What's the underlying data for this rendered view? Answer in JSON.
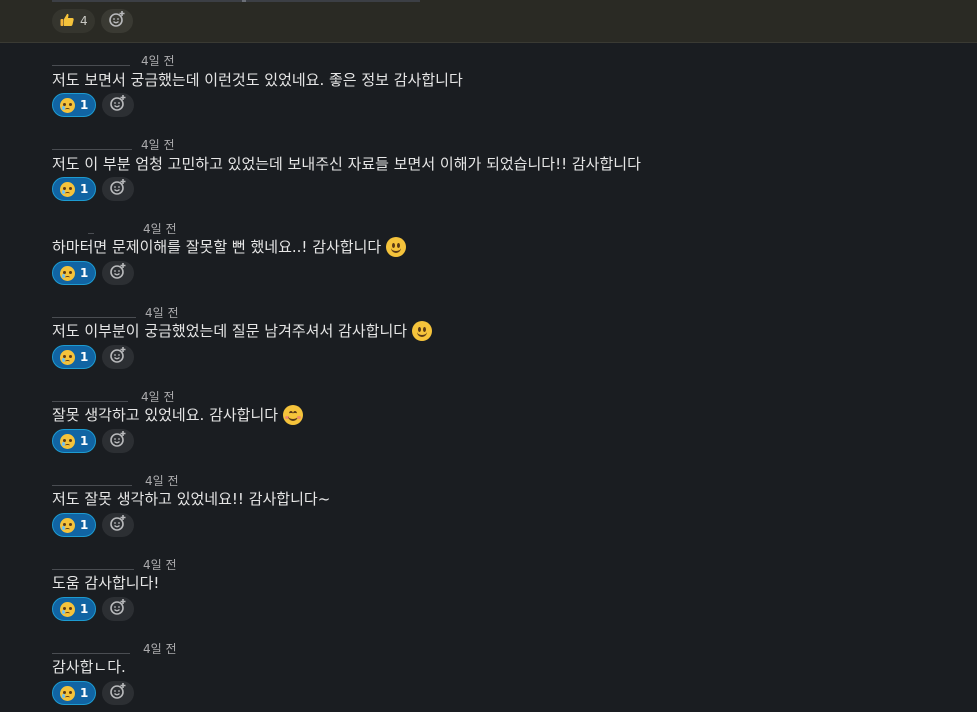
{
  "top_reactions": {
    "thumbs_count": "4"
  },
  "messages": [
    {
      "time": "4일 전",
      "text": "저도 보면서 궁금했는데 이런것도 있었네요. 좋은 정보 감사합니다",
      "emoji": "",
      "reaction_count": "1"
    },
    {
      "time": "4일 전",
      "text": "저도 이 부분 엄청 고민하고 있었는데 보내주신 자료들 보면서 이해가 되었습니다!! 감사합니다",
      "emoji": "",
      "reaction_count": "1"
    },
    {
      "time": "4일 전",
      "text": "하마터면 문제이해를 잘못할 뻔 했네요..! 감사합니다",
      "emoji": "slightly-smiling-face",
      "reaction_count": "1"
    },
    {
      "time": "4일 전",
      "text": "저도 이부분이 궁금했었는데 질문 남겨주셔서 감사합니다",
      "emoji": "slightly-smiling-face",
      "reaction_count": "1"
    },
    {
      "time": "4일 전",
      "text": "잘못 생각하고 있었네요. 감사합니다",
      "emoji": "smiling-face-with-smiling-eyes",
      "reaction_count": "1"
    },
    {
      "time": "4일 전",
      "text": "저도 잘못 생각하고 있었네요!! 감사합니다~",
      "emoji": "",
      "reaction_count": "1"
    },
    {
      "time": "4일 전",
      "text": "도움 감사합니다!",
      "emoji": "",
      "reaction_count": "1"
    },
    {
      "time": "4일 전",
      "text": "감사합ㄴ다.",
      "emoji": "",
      "reaction_count": "1"
    }
  ],
  "colors": {
    "background": "#1a1d21",
    "top_bar": "#2a2a24",
    "reaction_active": "#1164a3",
    "reaction_border": "#1d9bd1"
  }
}
